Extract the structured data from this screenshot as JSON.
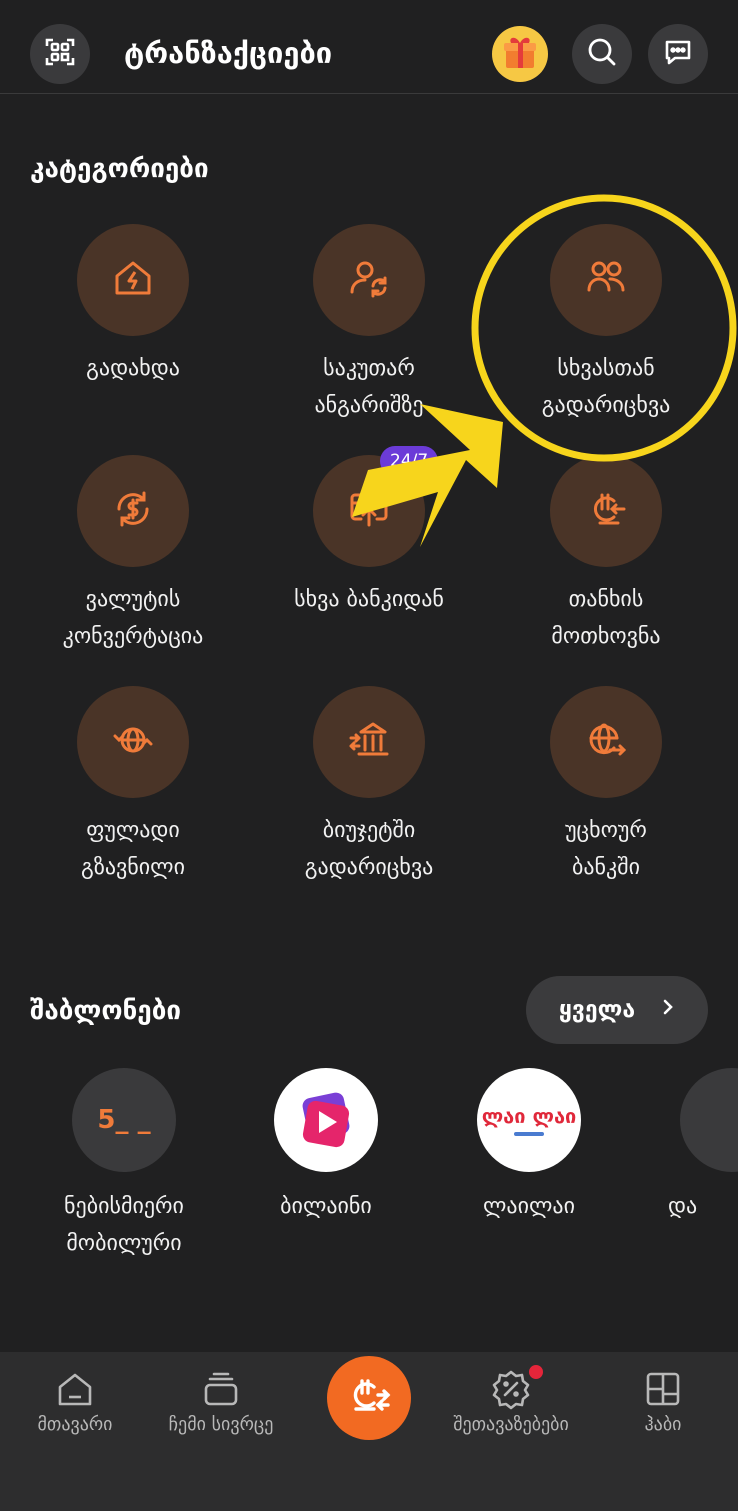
{
  "header": {
    "title": "ტრანზაქციები",
    "qr_icon": "qr-scan-icon",
    "gift_icon": "gift-icon",
    "search_icon": "search-icon",
    "chat_icon": "chat-icon"
  },
  "categories": {
    "title": "კატეგორიები",
    "items": [
      {
        "label": "გადახდა",
        "icon": "house-bolt-icon"
      },
      {
        "label": "საკუთარ\nანგარიშზე",
        "icon": "user-transfer-icon"
      },
      {
        "label": "სხვასთან\nგადარიცხვა",
        "icon": "users-icon"
      },
      {
        "label": "ვალუტის\nკონვერტაცია",
        "icon": "currency-exchange-icon"
      },
      {
        "label": "სხვა ბანკიდან",
        "icon": "card-upload-icon",
        "badge": "24/7"
      },
      {
        "label": "თანხის\nმოთხოვნა",
        "icon": "lari-request-icon"
      },
      {
        "label": "ფულადი\nგზავნილი",
        "icon": "globe-transfer-icon"
      },
      {
        "label": "ბიუჯეტში\nგადარიცხვა",
        "icon": "bank-transfer-icon"
      },
      {
        "label": "უცხოურ\nბანკში",
        "icon": "globe-arrow-icon"
      }
    ]
  },
  "templates": {
    "title": "შაბლონები",
    "all_label": "ყველა",
    "items": [
      {
        "label": "ნებისმიერი\nმობილური",
        "logo_text": "5_ _",
        "icon": "mobile-logo"
      },
      {
        "label": "ბილაინი",
        "icon": "beeline-play-logo"
      },
      {
        "label": "ლაილაი",
        "logo_text": "ლაი ლაი",
        "icon": "lailai-logo"
      },
      {
        "label": "და",
        "icon": "partial-logo"
      }
    ]
  },
  "bottom_nav": {
    "items": [
      {
        "label": "მთავარი",
        "icon": "home-icon"
      },
      {
        "label": "ჩემი სივრცე",
        "icon": "stack-icon"
      },
      {
        "label": "",
        "icon": "lari-transfer-icon"
      },
      {
        "label": "შეთავაზებები",
        "icon": "discount-badge-icon"
      },
      {
        "label": "ჰაბი",
        "icon": "grid-icon"
      }
    ]
  },
  "colors": {
    "background": "#202021",
    "accent": "#f26a22",
    "category_circle": "#4a3427",
    "highlight": "#f7d51c",
    "badge": "#6b3bd8"
  }
}
